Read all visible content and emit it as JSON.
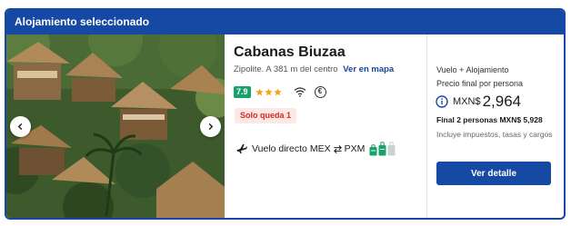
{
  "header": {
    "title": "Alojamiento seleccionado"
  },
  "hotel": {
    "name": "Cabanas Biuzaa",
    "location": "Zipolite. A 381 m del centro",
    "map_link": "Ver en mapa",
    "rating": "7.9",
    "stars": 3,
    "scarcity": "Solo queda 1"
  },
  "flight": {
    "label": "Vuelo directo",
    "origin": "MEX",
    "destination": "PXM"
  },
  "price": {
    "package_label": "Vuelo + Alojamiento",
    "per_person_label": "Precio final por persona",
    "currency": "MXN$",
    "amount": "2,964",
    "total": "Final 2 personas MXN$ 5,928",
    "taxes_note": "Incluye impuestos, tasas y cargos",
    "cta": "Ver detalle"
  },
  "colors": {
    "brand": "#1549a3",
    "rating": "#1aa06b",
    "stars": "#f2a20c",
    "scarcity_text": "#d22b1e",
    "bags": "#1aa06b"
  },
  "icons": [
    "chevron-left-icon",
    "chevron-right-icon",
    "star-icon",
    "wifi-icon",
    "euro-icon",
    "plane-icon",
    "swap-arrows-icon",
    "bag-icon",
    "info-icon"
  ]
}
